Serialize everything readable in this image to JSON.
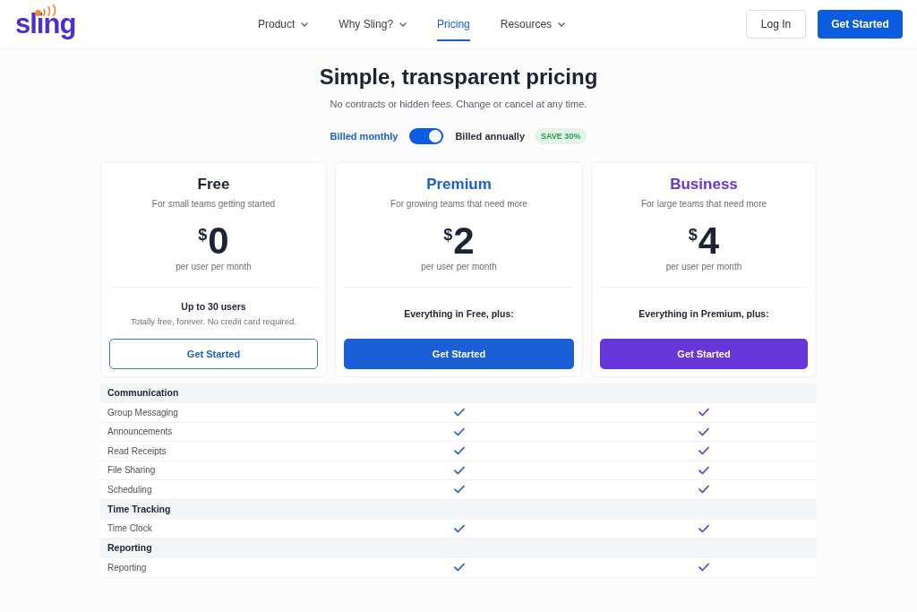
{
  "nav": {
    "logo": "sling",
    "items": [
      {
        "label": "Product",
        "has_menu": true,
        "selected": false
      },
      {
        "label": "Why Sling?",
        "has_menu": true,
        "selected": false
      },
      {
        "label": "Pricing",
        "has_menu": false,
        "selected": true
      },
      {
        "label": "Resources",
        "has_menu": true,
        "selected": false
      }
    ],
    "actions": [
      {
        "label": "Log In",
        "kind": "outline"
      },
      {
        "label": "Get Started",
        "kind": "primary"
      }
    ]
  },
  "hero": {
    "title": "Simple, transparent pricing",
    "subtitle": "No contracts or hidden fees. Change or cancel at any time."
  },
  "billing": {
    "options": [
      {
        "label": "Billed monthly",
        "selected": true
      },
      {
        "label": "Billed annually",
        "selected": false
      }
    ],
    "toggle_on": true,
    "badge": "SAVE 30%"
  },
  "plans": [
    {
      "name": "Free",
      "color": "#1d2433",
      "tagline": "For small teams getting started",
      "currency": "$",
      "amount": "0",
      "period": "per user per month",
      "headline": "Up to 30 users",
      "note": "Totally free, forever. No credit card required.",
      "button": {
        "label": "Get Started",
        "kind": "outline"
      }
    },
    {
      "name": "Premium",
      "color": "#1a5fd6",
      "tagline": "For growing teams that need more",
      "currency": "$",
      "amount": "2",
      "period": "per user per month",
      "headline": "Everything in Free, plus:",
      "button": {
        "label": "Get Started",
        "kind": "filled"
      }
    },
    {
      "name": "Business",
      "color": "#6636d8",
      "tagline": "For large teams that need more",
      "currency": "$",
      "amount": "4",
      "period": "per user per month",
      "headline": "Everything in Premium, plus:",
      "button": {
        "label": "Get Started",
        "kind": "filled"
      }
    }
  ],
  "features": {
    "sections": [
      {
        "title": "Communication",
        "rows": [
          {
            "label": "Group Messaging",
            "included": [
              false,
              true,
              true
            ]
          },
          {
            "label": "Announcements",
            "included": [
              false,
              true,
              true
            ]
          },
          {
            "label": "Read Receipts",
            "included": [
              false,
              true,
              true
            ]
          },
          {
            "label": "File Sharing",
            "included": [
              false,
              true,
              true
            ]
          },
          {
            "label": "Scheduling",
            "included": [
              false,
              true,
              true
            ]
          }
        ]
      },
      {
        "title": "Time Tracking",
        "rows": [
          {
            "label": "Time Clock",
            "included": [
              false,
              true,
              true
            ]
          }
        ]
      },
      {
        "title": "Reporting",
        "rows": [
          {
            "label": "Reporting",
            "included": [
              false,
              true,
              true
            ]
          }
        ]
      }
    ]
  }
}
